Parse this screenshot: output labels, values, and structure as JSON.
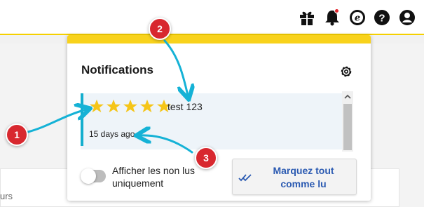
{
  "header": {
    "icons": [
      "gift-icon",
      "bell-icon",
      "e-circle-icon",
      "help-icon",
      "user-icon"
    ],
    "bell_has_badge": true
  },
  "background": {
    "partial_text": "urs"
  },
  "popup": {
    "title": "Notifications",
    "settings_icon": "gear-icon",
    "accent_color": "#f8d21c",
    "notifications": [
      {
        "rating": 5,
        "title": "test 123",
        "time": "15 days ago",
        "unread_color": "#13aece"
      }
    ],
    "toggle_label": "Afficher les non lus uniquement",
    "toggle_on": false,
    "mark_all_label": "Marquez tout comme lu"
  },
  "annotations": {
    "badges": [
      "1",
      "2",
      "3"
    ],
    "badge_color": "#d8282f",
    "arrow_color": "#15b2d6"
  }
}
